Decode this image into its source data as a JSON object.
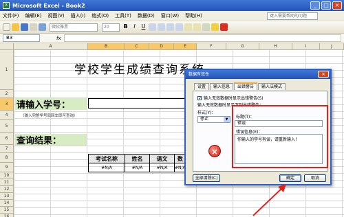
{
  "window": {
    "title": "Microsoft Excel - Book2"
  },
  "menu": {
    "items": [
      "文件(F)",
      "编辑(E)",
      "视图(V)",
      "插入(I)",
      "格式(O)",
      "工具(T)",
      "数据(D)",
      "窗口(W)",
      "帮助(H)"
    ],
    "help_placeholder": "键入需要帮助的问题"
  },
  "toolbar": {
    "font_name": "微软雅黑",
    "font_size": "20"
  },
  "formula_bar": {
    "name_box": "B3",
    "fx": "fx"
  },
  "columns": [
    "A",
    "B",
    "C",
    "D",
    "E",
    "F",
    "G",
    "H",
    "I",
    "J"
  ],
  "rows": [
    "1",
    "2",
    "3",
    "4",
    "5",
    "6",
    "7",
    "8",
    "9",
    "10",
    "11",
    "12",
    "13",
    "14",
    "15",
    "16"
  ],
  "sheet": {
    "main_title": "学校学生成绩查询系统",
    "student_id_label": "请输入学号：",
    "hint": "（输入完整学号后回车即可查询）",
    "result_label": "查询结果：",
    "table_headers": [
      "考试名称",
      "姓名",
      "语文",
      "数"
    ],
    "table_values": [
      "#N/A",
      "#N/A",
      "#N/A",
      "#N/A"
    ]
  },
  "dialog": {
    "title": "数据有效性",
    "tabs": [
      "设置",
      "输入信息",
      "出错警告",
      "输入法模式"
    ],
    "active_tab": "出错警告",
    "show_error_checkbox": "输入无效数据时显示出错警告(S)",
    "when_invalid": "输入无效数据时显示下列出错警告：",
    "style_label": "样式(Y)：",
    "style_value": "停止",
    "title_label": "标题(T)：",
    "title_value": "错误",
    "message_label": "错误信息(E)：",
    "message_value": "你输入的学号有误，请重新输入！",
    "clear_all": "全部清除(C)",
    "ok": "确定",
    "cancel": "取消"
  }
}
